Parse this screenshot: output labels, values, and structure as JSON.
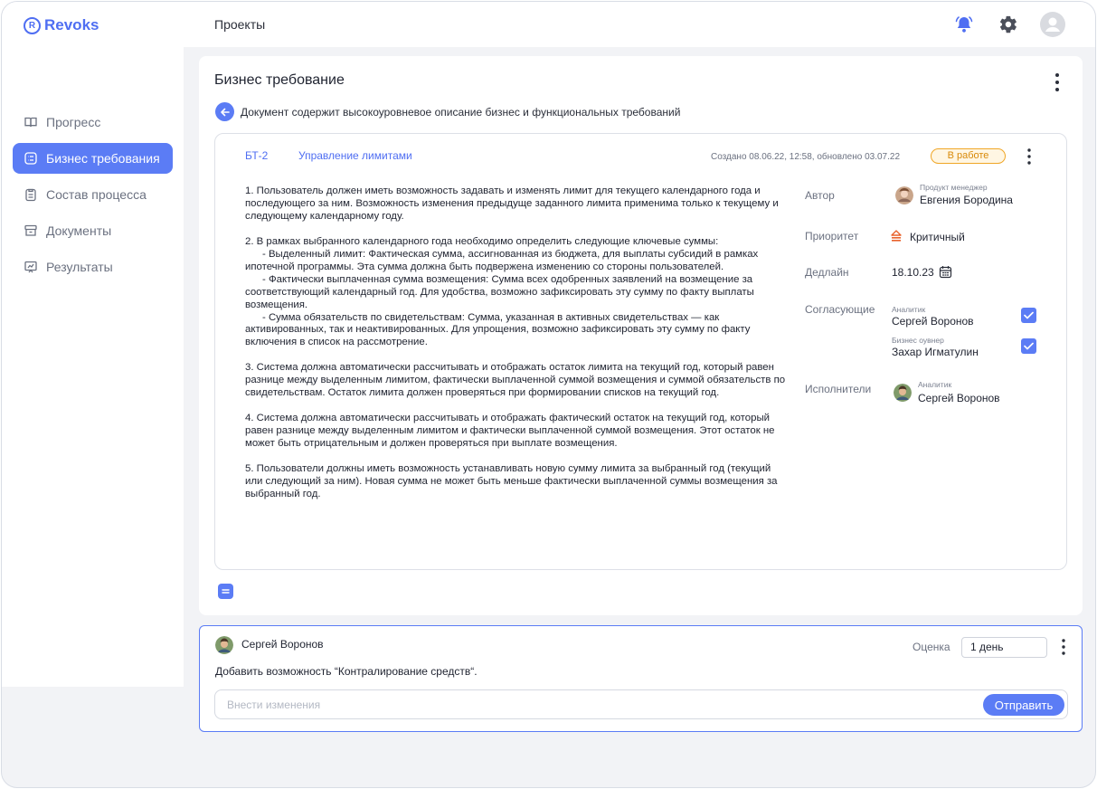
{
  "app": {
    "logo_letter": "R",
    "name": "Revoks"
  },
  "header": {
    "title": "Проекты",
    "icons": [
      "bell-icon",
      "gear-icon",
      "user-avatar-icon"
    ]
  },
  "sidebar": {
    "items": [
      {
        "label": "Прогресс",
        "icon": "book-icon",
        "active": false
      },
      {
        "label": "Бизнес требования",
        "icon": "list-icon",
        "active": true
      },
      {
        "label": "Состав процесса",
        "icon": "clipboard-icon",
        "active": false
      },
      {
        "label": "Документы",
        "icon": "archive-icon",
        "active": false
      },
      {
        "label": "Результаты",
        "icon": "presentation-icon",
        "active": false
      }
    ]
  },
  "card": {
    "title": "Бизнес требование",
    "description": "Документ содержит высокоуровневое описание бизнес и функциональных требований",
    "requirement": {
      "id": "БТ-2",
      "name": "Управление лимитами",
      "created": "Создано 08.06.22, 12:58, обновлено 03.07.22",
      "status": "В работе",
      "body": [
        "1. Пользователь должен иметь возможность задавать и изменять лимит для текущего календарного года и последующего за ним. Возможность изменения предыдуще заданного лимита применима только к текущему и следующему календарному году.",
        "",
        "2. В рамках выбранного календарного года необходимо определить следующие ключевые суммы:",
        "      - Выделенный лимит: Фактическая сумма, ассигнованная из бюджета, для выплаты субсидий в рамках ипотечной программы. Эта сумма должна быть подвержена изменению со стороны пользователей.",
        "      - Фактически выплаченная сумма возмещения: Сумма всех одобренных заявлений на возмещение за соответствующий календарный год. Для удобства, возможно зафиксировать эту сумму по факту выплаты возмещения.",
        "      - Сумма обязательств по свидетельствам: Сумма, указанная в активных свидетельствах — как активированных, так и неактивированных. Для упрощения, возможно зафиксировать эту сумму по факту включения в список на рассмотрение.",
        "",
        "3. Система должна автоматически рассчитывать и отображать остаток лимита на текущий год, который равен разнице между выделенным лимитом, фактически выплаченной суммой возмещения и суммой обязательств по свидетельствам. Остаток лимита должен проверяться при формировании списков на текущий год.",
        "",
        "4. Система должна автоматически рассчитывать и отображать фактический остаток на текущий год, который равен разнице между выделенным лимитом и фактически выплаченной суммой возмещения. Этот остаток не может быть отрицательным и должен проверяться при выплате возмещения.",
        "",
        "5. Пользователи должны иметь возможность устанавливать новую сумму лимита за выбранный год (текущий или следующий за ним). Новая сумма не может быть меньше фактически выплаченной суммы возмещения за выбранный год."
      ],
      "meta": {
        "author_label": "Автор",
        "author_role": "Продукт менеджер",
        "author_name": "Евгения Бородина",
        "priority_label": "Приоритет",
        "priority_value": "Критичный",
        "deadline_label": "Дедлайн",
        "deadline_value": "18.10.23",
        "approvers_label": "Согласующие",
        "approvers": [
          {
            "role": "Аналитик",
            "name": "Сергей Воронов",
            "checked": true
          },
          {
            "role": "Бизнес оувнер",
            "name": "Захар Игматулин",
            "checked": true
          }
        ],
        "executors_label": "Исполнители",
        "executor_role": "Аналитик",
        "executor_name": "Сергей Воронов"
      }
    }
  },
  "comment": {
    "author": "Сергей Воронов",
    "estimate_label": "Оценка",
    "estimate_value": "1 день",
    "text": "Добавить возможность “Контралирование средств“.",
    "input_placeholder": "Внести изменения",
    "send_label": "Отправить"
  },
  "colors": {
    "accent": "#5b7cf5",
    "status": "#f0a626",
    "priority": "#e8622c"
  }
}
